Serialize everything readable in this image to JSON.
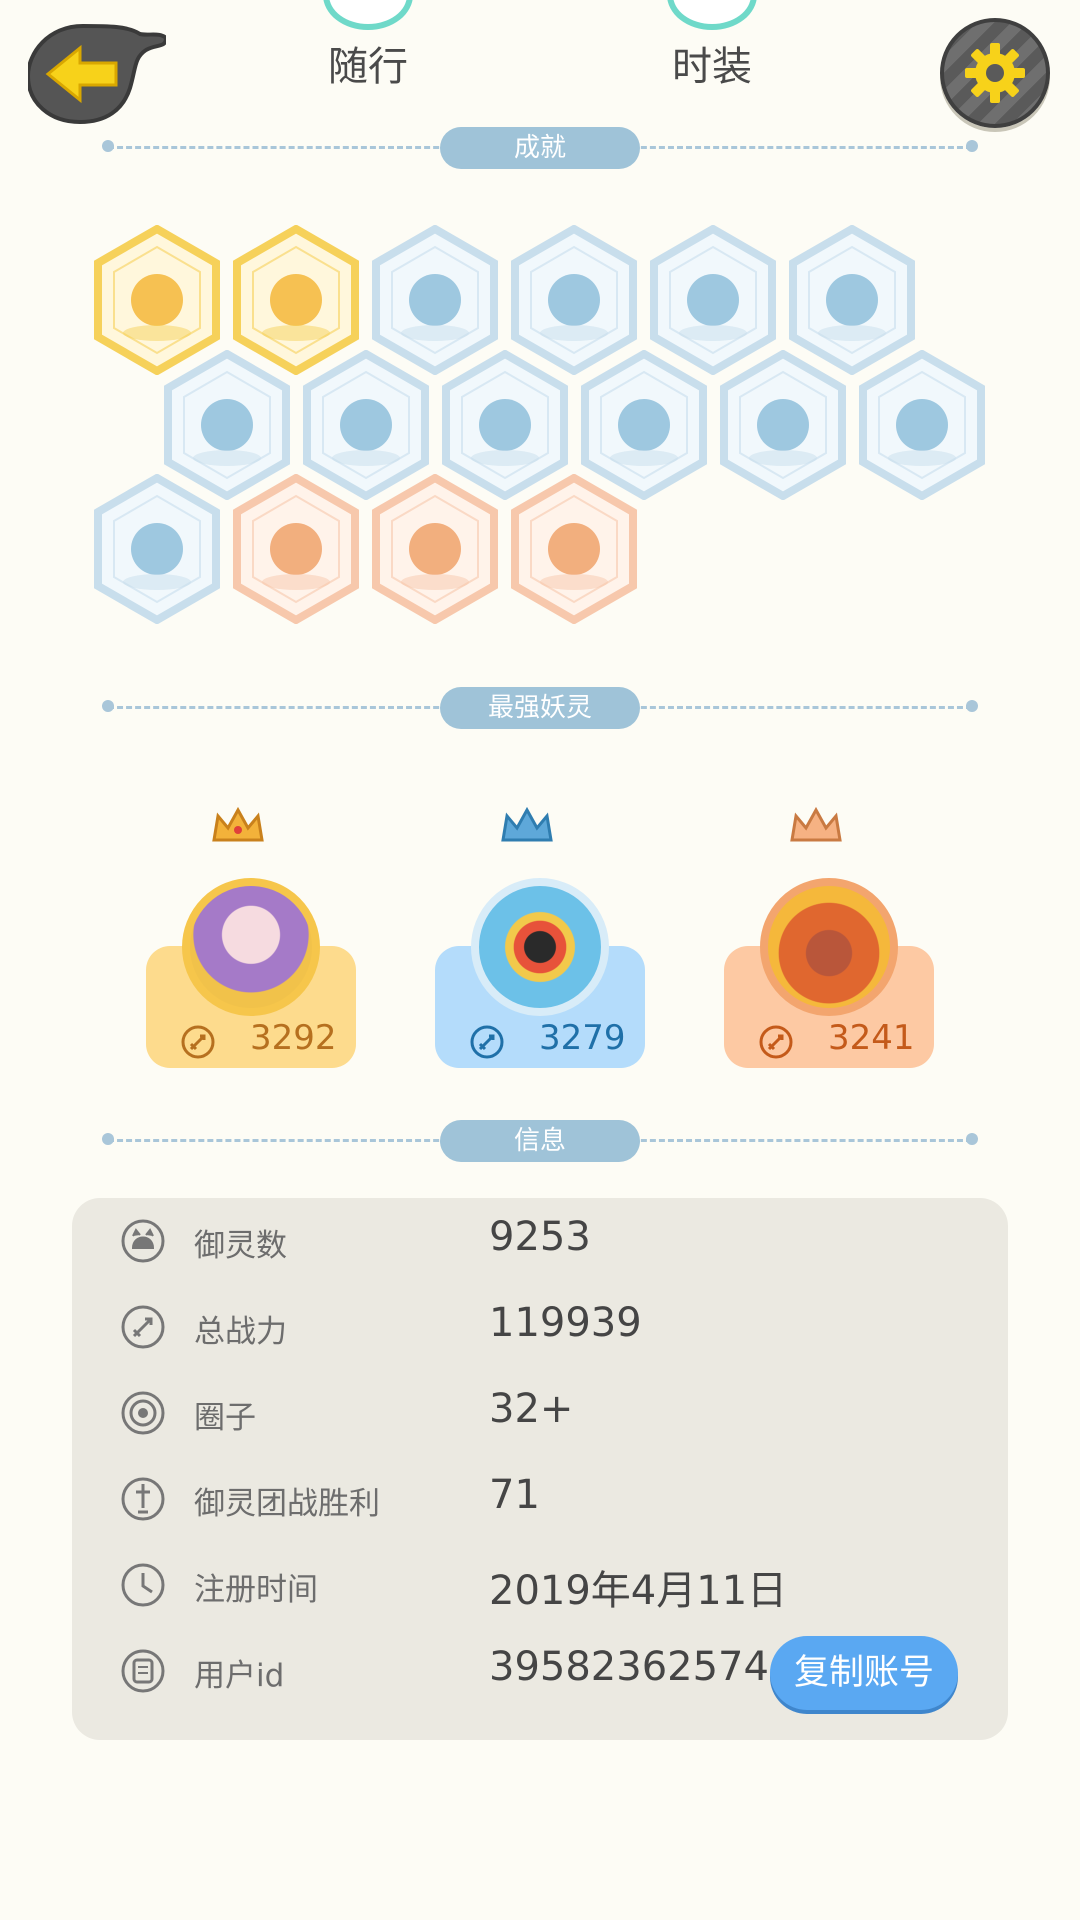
{
  "top": {
    "tabs": [
      {
        "label": "随行"
      },
      {
        "label": "时装"
      }
    ]
  },
  "sections": {
    "achievements": "成就",
    "strongest": "最强妖灵",
    "info": "信息"
  },
  "achievements": [
    {
      "style": "gold",
      "icon": "fox-face-badge"
    },
    {
      "style": "gold",
      "icon": "golden-orb-badge"
    },
    {
      "style": "blue",
      "icon": "sneaker-badge"
    },
    {
      "style": "blue",
      "icon": "portal-badge"
    },
    {
      "style": "blue",
      "icon": "moon-badge"
    },
    {
      "style": "blue",
      "icon": "crystal-badge"
    },
    {
      "style": "blue",
      "icon": "yin-yang-wave-badge"
    },
    {
      "style": "blue",
      "icon": "fairy-figure-badge"
    },
    {
      "style": "blue",
      "icon": "stroller-badge"
    },
    {
      "style": "blue",
      "icon": "cat-wand-badge"
    },
    {
      "style": "blue",
      "icon": "yin-yang-scroll-badge"
    },
    {
      "style": "blue",
      "icon": "shield-badge"
    },
    {
      "style": "blue",
      "icon": "ghost-badge"
    },
    {
      "style": "orange",
      "icon": "koi-badge"
    },
    {
      "style": "orange",
      "icon": "horned-statue-badge"
    },
    {
      "style": "orange",
      "icon": "fox-book-badge"
    }
  ],
  "champions": [
    {
      "power": "3292",
      "theme": "gold",
      "card_color": "#fddb8d",
      "text_color": "#b6701f"
    },
    {
      "power": "3279",
      "theme": "blue",
      "card_color": "#b4dcfb",
      "text_color": "#1f70a8"
    },
    {
      "power": "3241",
      "theme": "orange",
      "card_color": "#fdc9a3",
      "text_color": "#c45a1a"
    }
  ],
  "info": {
    "rows": [
      {
        "icon": "spirit-icon",
        "label": "御灵数",
        "value": "9253"
      },
      {
        "icon": "sword-icon",
        "label": "总战力",
        "value": "119939"
      },
      {
        "icon": "circle-target-icon",
        "label": "圈子",
        "value": "32+"
      },
      {
        "icon": "trophy-sword-icon",
        "label": "御灵团战胜利",
        "value": "71"
      },
      {
        "icon": "clock-icon",
        "label": "注册时间",
        "value": "2019年4月11日"
      },
      {
        "icon": "id-card-icon",
        "label": "用户id",
        "value": "39582362574"
      }
    ],
    "copy_label": "复制账号"
  },
  "colors": {
    "background": "#fdfcf5",
    "pill": "#9fc3d8",
    "panel": "#ebe9e1",
    "copy_button": "#5aa8f2",
    "gear": "#f7d21a",
    "back_arrow": "#f7d21a"
  }
}
